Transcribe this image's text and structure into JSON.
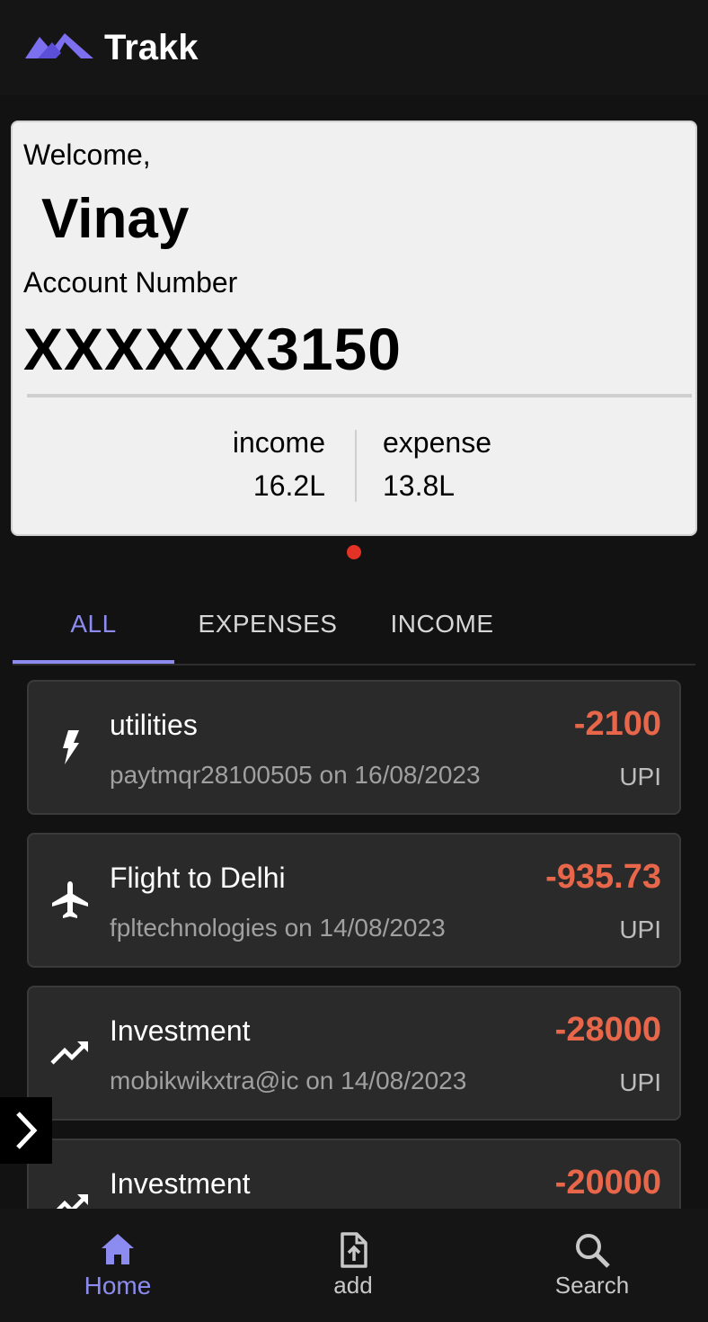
{
  "app": {
    "title": "Trakk",
    "accent": "#8c8cf0"
  },
  "card": {
    "welcome": "Welcome,",
    "username": "Vinay",
    "account_label": "Account Number",
    "account_number": "XXXXXX3150",
    "income_label": "income",
    "income_value": "16.2L",
    "expense_label": "expense",
    "expense_value": "13.8L"
  },
  "carousel": {
    "active_index": 0,
    "dot_color": "#e53226"
  },
  "tabs": [
    {
      "label": "ALL",
      "active": true
    },
    {
      "label": "EXPENSES",
      "active": false
    },
    {
      "label": "INCOME",
      "active": false
    }
  ],
  "transactions": [
    {
      "icon": "lightning-icon",
      "title": "utilities",
      "subtitle": "paytmqr28100505 on 16/08/2023",
      "amount": "-2100",
      "mode": "UPI"
    },
    {
      "icon": "airplane-icon",
      "title": "Flight to Delhi",
      "subtitle": "fpltechnologies on 14/08/2023",
      "amount": "-935.73",
      "mode": "UPI"
    },
    {
      "icon": "trending-up-icon",
      "title": "Investment",
      "subtitle": "mobikwikxtra@ic on 14/08/2023",
      "amount": "-28000",
      "mode": "UPI"
    },
    {
      "icon": "trending-up-icon",
      "title": "Investment",
      "subtitle": "",
      "amount": "-20000",
      "mode": ""
    }
  ],
  "nav": {
    "home_label": "Home",
    "add_label": "add",
    "search_label": "Search"
  },
  "colors": {
    "amount_negative": "#e8674a",
    "card_bg": "#f0f0f0",
    "background": "#121212"
  }
}
